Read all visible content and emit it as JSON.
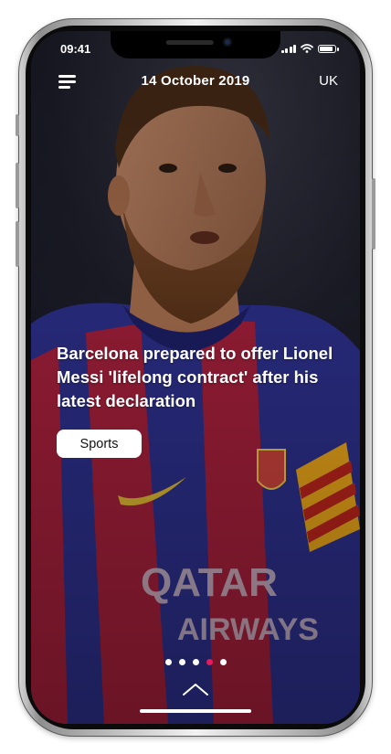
{
  "status_bar": {
    "time": "09:41"
  },
  "header": {
    "date": "14 October 2019",
    "region": "UK",
    "menu_icon": "hamburger-menu-icon"
  },
  "article": {
    "headline": "Barcelona prepared to offer Lionel Messi 'lifelong contract' after his latest declaration",
    "category": "Sports",
    "image_text": "QATAR AIRWAYS"
  },
  "carousel": {
    "count": 5,
    "active_index": 3
  },
  "colors": {
    "accent": "#e8195c",
    "text": "#ffffff",
    "tag_bg": "#ffffff"
  }
}
